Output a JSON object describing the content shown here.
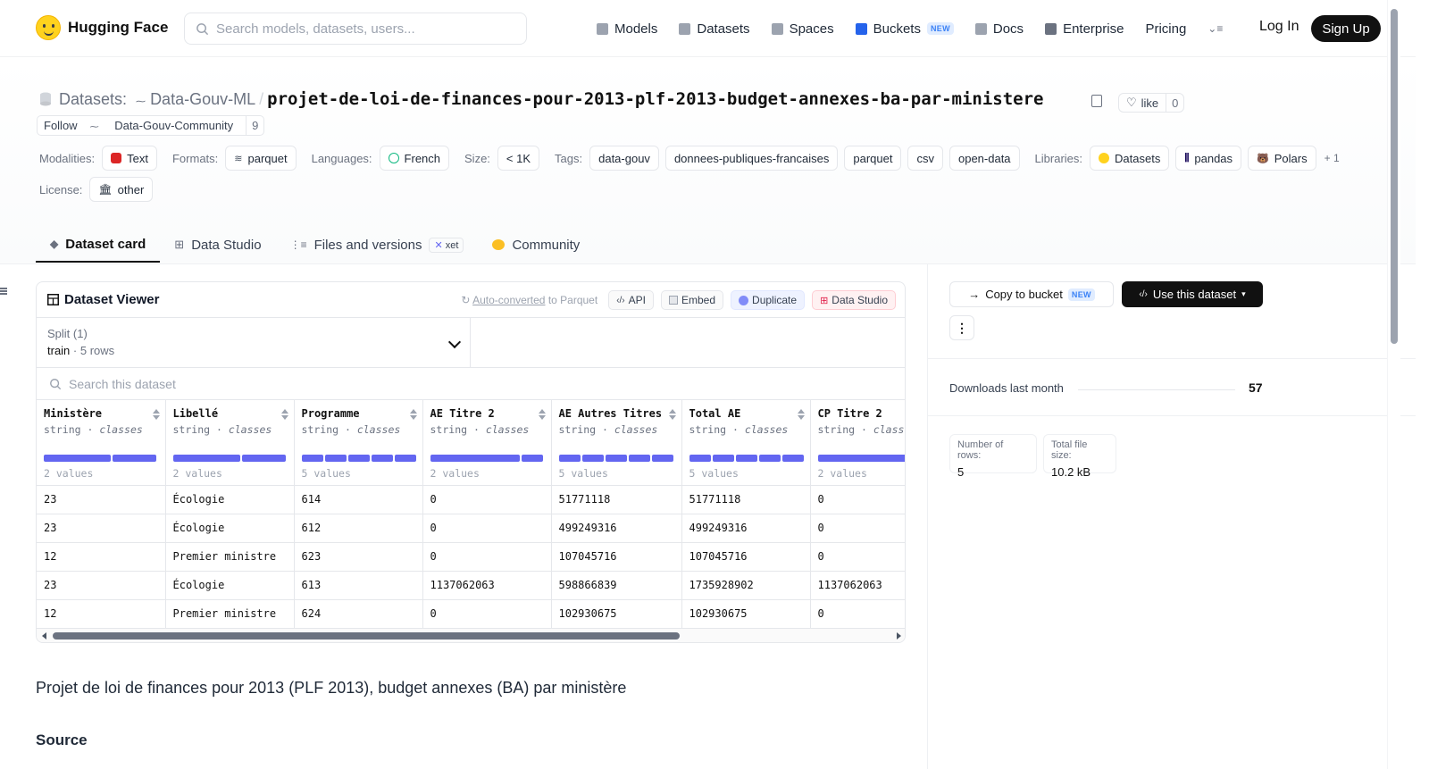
{
  "header": {
    "brand": "Hugging Face",
    "search_placeholder": "Search models, datasets, users...",
    "nav": [
      {
        "label": "Models",
        "icon": "cube-icon",
        "color": "#9ca3af"
      },
      {
        "label": "Datasets",
        "icon": "database-icon",
        "color": "#9ca3af"
      },
      {
        "label": "Spaces",
        "icon": "grid-icon",
        "color": "#9ca3af"
      },
      {
        "label": "Buckets",
        "icon": "bucket-icon",
        "color": "#2563eb",
        "badge": "NEW"
      },
      {
        "label": "Docs",
        "icon": "book-icon",
        "color": "#9ca3af"
      },
      {
        "label": "Enterprise",
        "icon": "enterprise-icon",
        "color": "#6b7280"
      },
      {
        "label": "Pricing"
      }
    ],
    "login": "Log In",
    "signup": "Sign Up"
  },
  "dataset": {
    "prefix": "Datasets:",
    "org": "Data-Gouv-ML",
    "separator": "/",
    "name": "projet-de-loi-de-finances-pour-2013-plf-2013-budget-annexes-ba-par-ministere",
    "like_label": "like",
    "like_count": "0",
    "follow_label": "Follow",
    "follow_org": "Data-Gouv-Community",
    "follow_count": "9"
  },
  "tags": {
    "modalities_label": "Modalities:",
    "modalities": [
      "Text"
    ],
    "formats_label": "Formats:",
    "formats": [
      "parquet"
    ],
    "languages_label": "Languages:",
    "languages": [
      "French"
    ],
    "size_label": "Size:",
    "size": "< 1K",
    "tags_label": "Tags:",
    "tags": [
      "data-gouv",
      "donnees-publiques-francaises",
      "parquet",
      "csv",
      "open-data"
    ],
    "libraries_label": "Libraries:",
    "libraries": [
      "Datasets",
      "pandas",
      "Polars"
    ],
    "libraries_more": "+ 1",
    "license_label": "License:",
    "license": "other"
  },
  "tabs": [
    {
      "label": "Dataset card",
      "active": true
    },
    {
      "label": "Data Studio"
    },
    {
      "label": "Files and versions",
      "badge": "xet"
    },
    {
      "label": "Community"
    }
  ],
  "viewer": {
    "title": "Dataset Viewer",
    "auto_converted_link": "Auto-converted",
    "auto_converted_rest": " to Parquet",
    "api": "API",
    "embed": "Embed",
    "duplicate": "Duplicate",
    "studio": "Data Studio",
    "split_label": "Split (1)",
    "split_value": "train",
    "split_dot": "·",
    "split_rows": "5 rows",
    "search_placeholder": "Search this dataset",
    "columns": [
      {
        "name": "Ministère",
        "type": "string",
        "kind": "classes",
        "values": "2 values",
        "bars": [
          0.6,
          0.4
        ]
      },
      {
        "name": "Libellé",
        "type": "string",
        "kind": "classes",
        "values": "2 values",
        "bars": [
          0.6,
          0.4
        ]
      },
      {
        "name": "Programme",
        "type": "string",
        "kind": "classes",
        "values": "5 values",
        "bars": [
          0.2,
          0.2,
          0.2,
          0.2,
          0.2
        ]
      },
      {
        "name": "AE Titre 2",
        "type": "string",
        "kind": "classes",
        "values": "2 values",
        "bars": [
          0.8,
          0.2
        ]
      },
      {
        "name": "AE Autres Titres",
        "type": "string",
        "kind": "classes",
        "values": "5 values",
        "bars": [
          0.2,
          0.2,
          0.2,
          0.2,
          0.2
        ]
      },
      {
        "name": "Total AE",
        "type": "string",
        "kind": "classes",
        "values": "5 values",
        "bars": [
          0.2,
          0.2,
          0.2,
          0.2,
          0.2
        ]
      },
      {
        "name": "CP Titre 2",
        "type": "string",
        "kind": "classes",
        "values": "2 values",
        "bars": [
          0.8,
          0.2
        ]
      }
    ],
    "rows": [
      [
        "23",
        "Écologie",
        "614",
        "0",
        "51771118",
        "51771118",
        "0"
      ],
      [
        "23",
        "Écologie",
        "612",
        "0",
        "499249316",
        "499249316",
        "0"
      ],
      [
        "12",
        "Premier ministre",
        "623",
        "0",
        "107045716",
        "107045716",
        "0"
      ],
      [
        "23",
        "Écologie",
        "613",
        "1137062063",
        "598866839",
        "1735928902",
        "1137062063"
      ],
      [
        "12",
        "Premier ministre",
        "624",
        "0",
        "102930675",
        "102930675",
        "0"
      ]
    ]
  },
  "card": {
    "heading": "Projet de loi de finances pour 2013 (PLF 2013), budget annexes (BA) par ministère",
    "source_heading": "Source"
  },
  "sidebar": {
    "copy_bucket": "Copy to bucket",
    "copy_badge": "NEW",
    "use_dataset": "Use this dataset",
    "downloads_label": "Downloads last month",
    "downloads_value": "57",
    "rows_label": "Number of rows:",
    "rows_value": "5",
    "size_label": "Total file size:",
    "size_value": "10.2 kB"
  }
}
